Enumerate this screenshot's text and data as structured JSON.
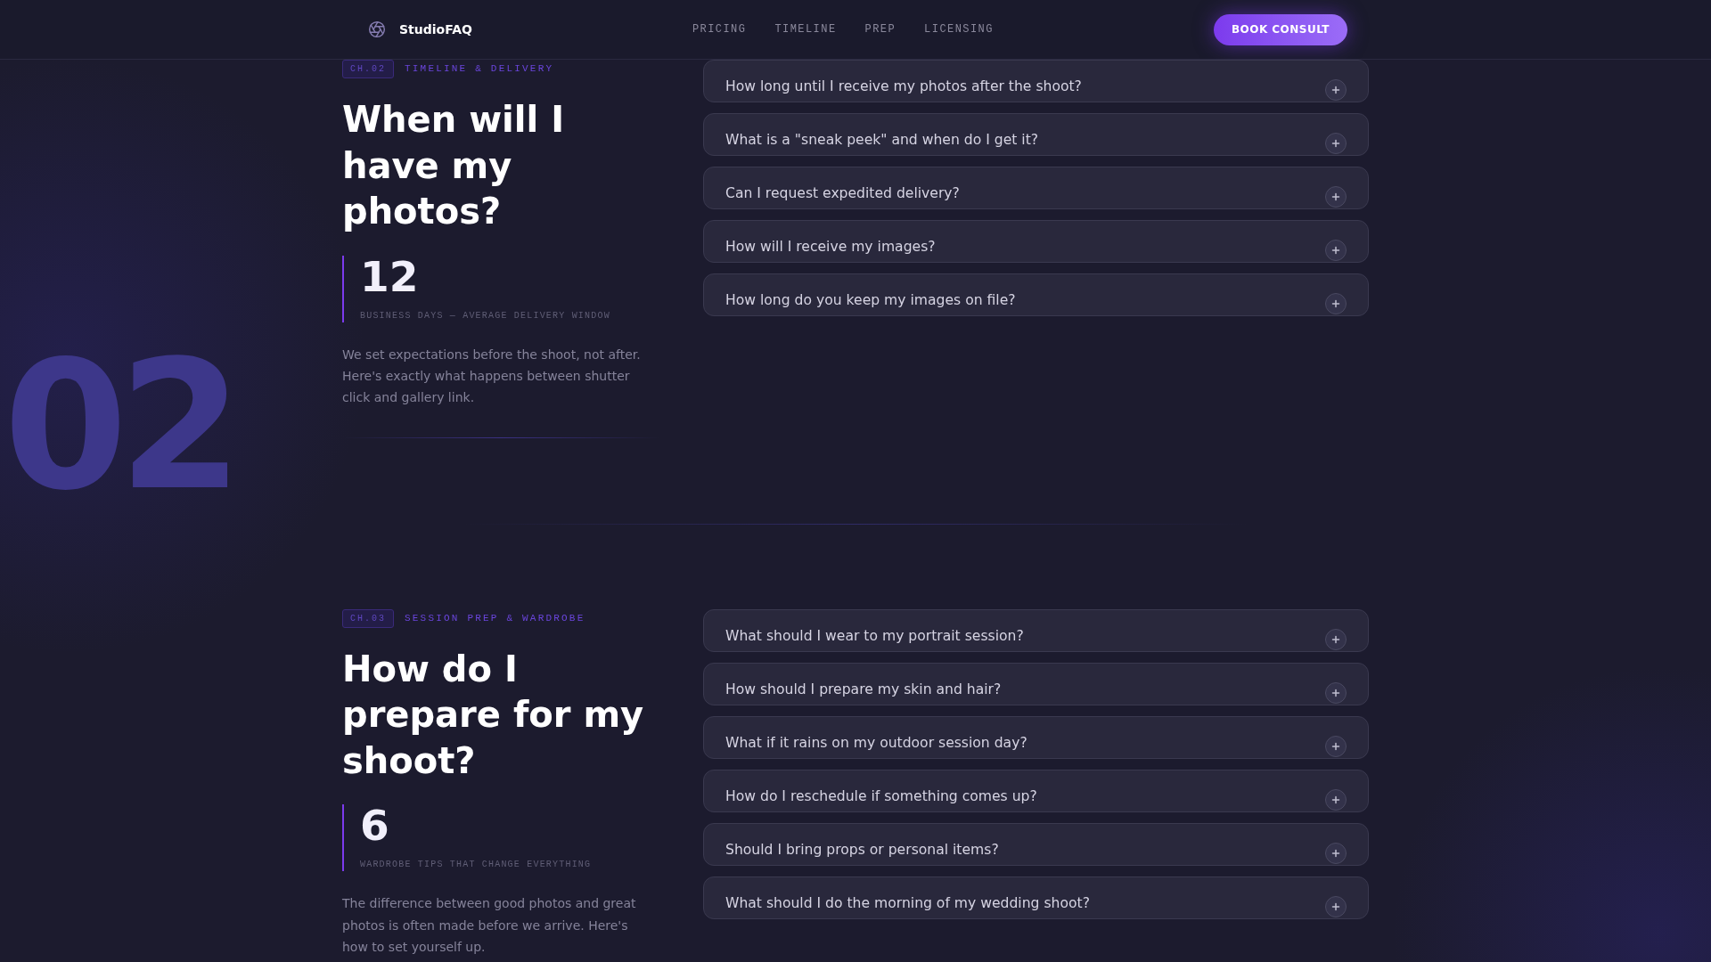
{
  "header": {
    "brand": "StudioFAQ",
    "nav": [
      "PRICING",
      "TIMELINE",
      "PREP",
      "LICENSING"
    ],
    "cta": "BOOK CONSULT"
  },
  "sections": [
    {
      "chapter": "CH.02",
      "eyebrow": "TIMELINE & DELIVERY",
      "title": "When will I have my photos?",
      "stat": {
        "value": "12",
        "label": "BUSINESS DAYS — AVERAGE DELIVERY WINDOW"
      },
      "intro": "We set expectations before the shoot, not after. Here's exactly what happens between shutter click and gallery link.",
      "backdrop_number": "02",
      "faqs": [
        {
          "question": "How long until I receive my photos after the shoot?",
          "expanded": false
        },
        {
          "question": "What is a \"sneak peek\" and when do I get it?",
          "expanded": false
        },
        {
          "question": "Can I request expedited delivery?",
          "expanded": false
        },
        {
          "question": "How will I receive my images?",
          "expanded": false
        },
        {
          "question": "How long do you keep my images on file?",
          "expanded": false
        }
      ]
    },
    {
      "chapter": "CH.03",
      "eyebrow": "SESSION PREP & WARDROBE",
      "title": "How do I prepare for my shoot?",
      "stat": {
        "value": "6",
        "label": "WARDROBE TIPS THAT CHANGE EVERYTHING"
      },
      "intro": "The difference between good photos and great photos is often made before we arrive. Here's how to set yourself up.",
      "faqs": [
        {
          "question": "What should I wear to my portrait session?",
          "expanded": false
        },
        {
          "question": "How should I prepare my skin and hair?",
          "expanded": false
        },
        {
          "question": "What if it rains on my outdoor session day?",
          "expanded": false
        },
        {
          "question": "How do I reschedule if something comes up?",
          "expanded": false
        },
        {
          "question": "Should I bring props or personal items?",
          "expanded": false
        },
        {
          "question": "What should I do the morning of my wedding shoot?",
          "expanded": false
        }
      ]
    }
  ]
}
